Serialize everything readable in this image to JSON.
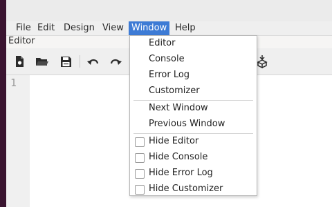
{
  "menubar": {
    "items": [
      {
        "label": "File"
      },
      {
        "label": "Edit"
      },
      {
        "label": "Design"
      },
      {
        "label": "View"
      },
      {
        "label": "Window"
      },
      {
        "label": "Help"
      }
    ]
  },
  "panel": {
    "title": "Editor"
  },
  "toolbar": {
    "buttons": [
      "new-file-icon",
      "open-folder-icon",
      "save-icon",
      "undo-icon",
      "redo-icon"
    ]
  },
  "editor": {
    "line_numbers": [
      "1"
    ]
  },
  "window_menu": {
    "items": [
      {
        "label": "Editor"
      },
      {
        "label": "Console"
      },
      {
        "label": "Error Log"
      },
      {
        "label": "Customizer"
      },
      {
        "label": "Next Window"
      },
      {
        "label": "Previous Window"
      },
      {
        "label": "Hide Editor",
        "checked": false
      },
      {
        "label": "Hide Console",
        "checked": false
      },
      {
        "label": "Hide Error Log",
        "checked": false
      },
      {
        "label": "Hide Customizer",
        "checked": false
      }
    ]
  },
  "colors": {
    "menu_highlight": "#3d7bd5",
    "desktop": "#3a1430"
  }
}
